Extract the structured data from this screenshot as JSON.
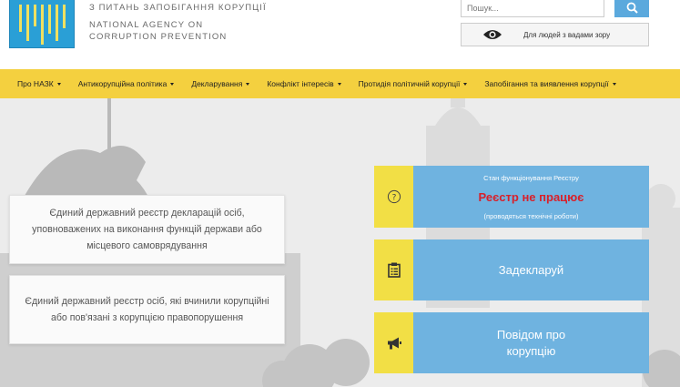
{
  "header": {
    "agency_ua": "З ПИТАНЬ ЗАПОБІГАННЯ КОРУПЦІЇ",
    "agency_en_line1": "NATIONAL AGENCY ON",
    "agency_en_line2": "CORRUPTION PREVENTION",
    "search_placeholder": "Пошук...",
    "vision_label": "Для людей з вадами зору"
  },
  "nav": {
    "items": [
      {
        "label": "Про НАЗК"
      },
      {
        "label": "Антикорупційна політика"
      },
      {
        "label": "Декларування"
      },
      {
        "label": "Конфлікт інтересів"
      },
      {
        "label": "Протидія політичній корупції"
      },
      {
        "label": "Запобігання та виявлення корупції"
      }
    ]
  },
  "cards": [
    {
      "text": "Єдиний державний реєстр декларацій осіб, уповноважених на виконання функцій держави або місцевого самоврядування"
    },
    {
      "text": "Єдиний державний реєстр осіб, які вчинили корупційні або пов'язані з корупцією правопорушення"
    }
  ],
  "status": {
    "title": "Стан функціонування Реєстру",
    "main": "Реєстр не працює",
    "note": "(проводяться технічні роботи)"
  },
  "actions": {
    "declare": "Задекларуй",
    "report": "Повідом про корупцію"
  },
  "colors": {
    "nav_bg": "#f4d03f",
    "block_blue": "#6fb3e0",
    "icon_yellow": "#f2df45",
    "status_red": "#d8202a",
    "logo_blue": "#2a9fd6"
  }
}
